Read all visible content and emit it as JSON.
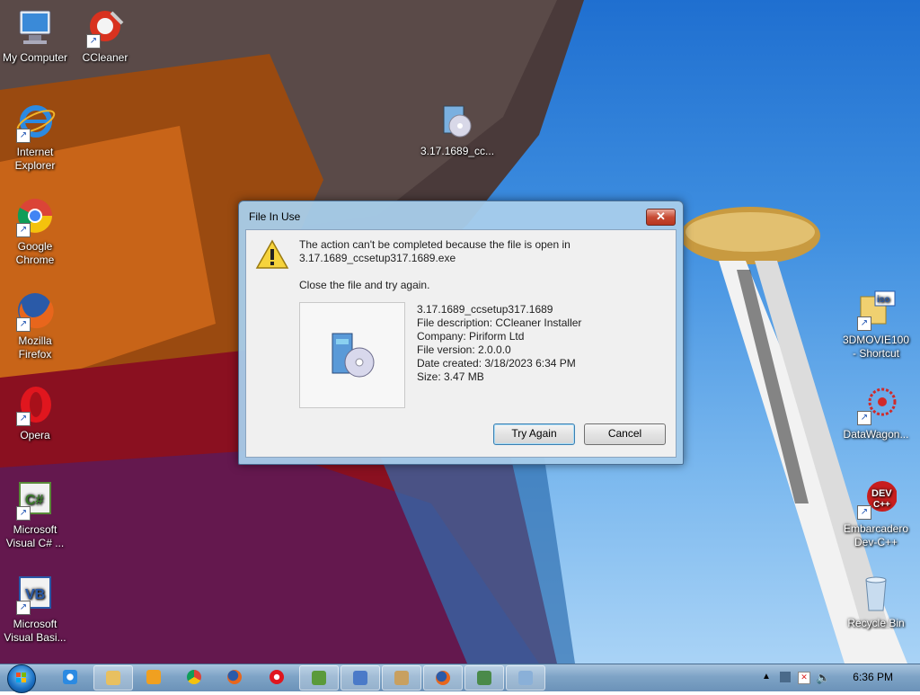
{
  "desktop": {
    "icons_left": [
      {
        "label": "My Computer"
      },
      {
        "label": "CCleaner"
      },
      {
        "label": "Internet\nExplorer"
      },
      {
        "label": "Google\nChrome"
      },
      {
        "label": "Mozilla\nFirefox"
      },
      {
        "label": "Opera"
      },
      {
        "label": "Microsoft\nVisual C# ..."
      },
      {
        "label": "Microsoft\nVisual Basi..."
      }
    ],
    "icon_center": {
      "label": "3.17.1689_cc..."
    },
    "icons_right": [
      {
        "label": "3DMOVIE100\n- Shortcut"
      },
      {
        "label": "DataWagon..."
      },
      {
        "label": "Embarcadero\nDev-C++"
      },
      {
        "label": "Recycle Bin"
      }
    ]
  },
  "dialog": {
    "title": "File In Use",
    "close_glyph": "✕",
    "message_line1": "The action can't be completed because the file is open in",
    "message_line2": "3.17.1689_ccsetup317.1689.exe",
    "instruction": "Close the file and try again.",
    "file_info": {
      "name": "3.17.1689_ccsetup317.1689",
      "description": "File description: CCleaner Installer",
      "company": "Company: Piriform Ltd",
      "version": "File version: 2.0.0.0",
      "created": "Date created: 3/18/2023 6:34 PM",
      "size": "Size: 3.47 MB"
    },
    "try_again_label": "Try Again",
    "cancel_label": "Cancel"
  },
  "taskbar": {
    "clock": "6:36 PM",
    "pinned": [
      "internet-explorer",
      "windows-explorer",
      "media-player",
      "chrome",
      "firefox",
      "opera",
      "visual-csharp",
      "visual-basic",
      "paint",
      "firefox-window",
      "dev-tool",
      "installer"
    ]
  },
  "colors": {
    "accent": "#3c7fb1",
    "close": "#c74b34"
  }
}
